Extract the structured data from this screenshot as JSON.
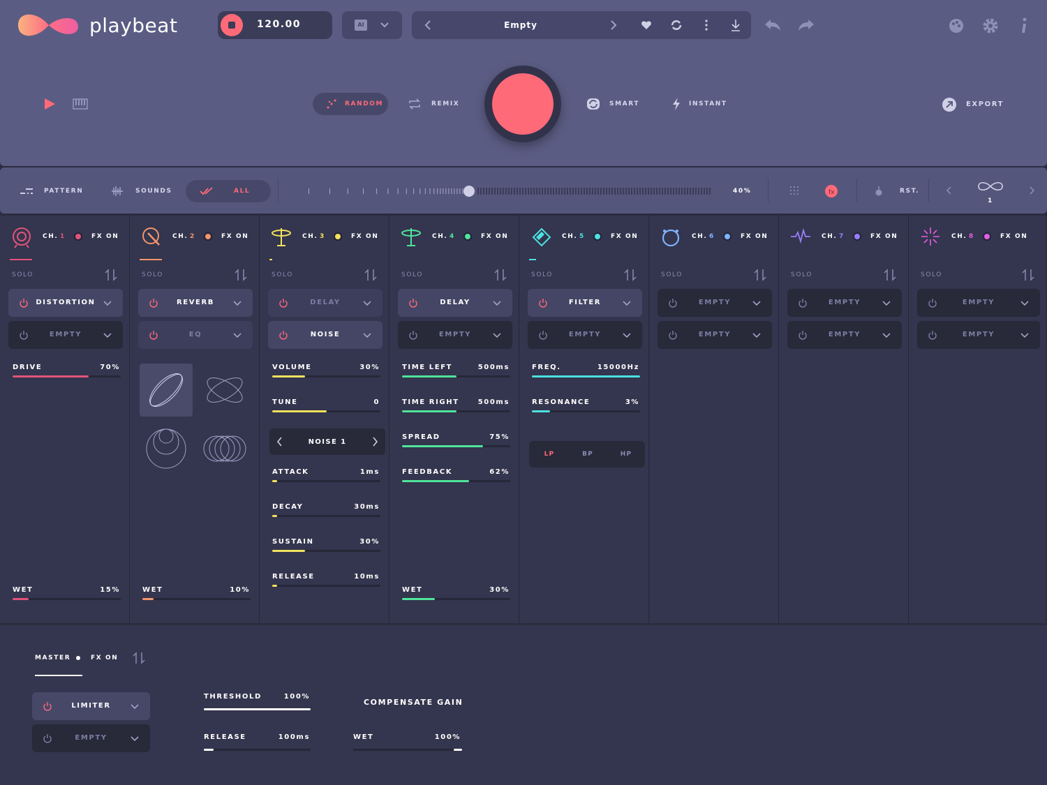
{
  "app": {
    "name": "playbeat",
    "bpm": "120.00",
    "ai_label": "AI",
    "preset": "Empty"
  },
  "actions": {
    "random": "RANDOM",
    "remix": "REMIX",
    "smart": "SMART",
    "instant": "INSTANT",
    "export": "EXPORT"
  },
  "bar2": {
    "pattern": "PATTERN",
    "sounds": "SOUNDS",
    "all": "ALL",
    "percent": "40%",
    "level": 0.4,
    "rst": "RST.",
    "loop_count": "1"
  },
  "solo": "SOLO",
  "fx_on": "FX ON",
  "channels": [
    {
      "ch": "CH.",
      "num": "1",
      "color": "#e2537a",
      "fx1": "DISTORTION",
      "fx2": "EMPTY",
      "params": [
        {
          "name": "DRIVE",
          "value": "70%",
          "level": 0.7
        }
      ],
      "wet": {
        "name": "WET",
        "value": "15%",
        "level": 0.15
      }
    },
    {
      "ch": "CH.",
      "num": "2",
      "color": "#f39669",
      "fx1": "REVERB",
      "fx2": "EQ",
      "wet": {
        "name": "WET",
        "value": "10%",
        "level": 0.1
      }
    },
    {
      "ch": "CH.",
      "num": "3",
      "color": "#f2e25d",
      "fx1": "DELAY",
      "fx2": "NOISE",
      "params": [
        {
          "name": "VOLUME",
          "value": "30%",
          "level": 0.3
        },
        {
          "name": "TUNE",
          "value": "0",
          "level": 0.5
        },
        {
          "name": "ATTACK",
          "value": "1ms",
          "level": 0.02
        },
        {
          "name": "DECAY",
          "value": "30ms",
          "level": 0.03
        },
        {
          "name": "SUSTAIN",
          "value": "30%",
          "level": 0.3
        },
        {
          "name": "RELEASE",
          "value": "10ms",
          "level": 0.02
        }
      ],
      "selector": "NOISE 1"
    },
    {
      "ch": "CH.",
      "num": "4",
      "color": "#4fe59a",
      "fx1": "DELAY",
      "fx2": "EMPTY",
      "params": [
        {
          "name": "TIME LEFT",
          "value": "500ms",
          "level": 0.5
        },
        {
          "name": "TIME RIGHT",
          "value": "500ms",
          "level": 0.5
        },
        {
          "name": "SPREAD",
          "value": "75%",
          "level": 0.75
        },
        {
          "name": "FEEDBACK",
          "value": "62%",
          "level": 0.62
        }
      ],
      "wet": {
        "name": "WET",
        "value": "30%",
        "level": 0.3
      }
    },
    {
      "ch": "CH.",
      "num": "5",
      "color": "#4be2e0",
      "fx1": "FILTER",
      "fx2": "EMPTY",
      "params": [
        {
          "name": "FREQ.",
          "value": "15000Hz",
          "level": 1.0
        },
        {
          "name": "RESONANCE",
          "value": "3%",
          "level": 0.17
        }
      ],
      "modes": [
        "LP",
        "BP",
        "HP"
      ]
    },
    {
      "ch": "CH.",
      "num": "6",
      "color": "#7fb3ff",
      "fx1": "EMPTY",
      "fx2": "EMPTY"
    },
    {
      "ch": "CH.",
      "num": "7",
      "color": "#9a7cff",
      "fx1": "EMPTY",
      "fx2": "EMPTY"
    },
    {
      "ch": "CH.",
      "num": "8",
      "color": "#e05fe0",
      "fx1": "EMPTY",
      "fx2": "EMPTY"
    }
  ],
  "master": {
    "label": "MASTER",
    "fx_on": "FX ON",
    "fx1": "LIMITER",
    "fx2": "EMPTY",
    "threshold": {
      "name": "THRESHOLD",
      "value": "100%",
      "level": 1.0
    },
    "release": {
      "name": "RELEASE",
      "value": "100ms",
      "level": 0.08
    },
    "compensate": "COMPENSATE GAIN",
    "wet": {
      "name": "WET",
      "value": "100%",
      "level": 1.0
    }
  },
  "colors": {
    "accent": "#ff6a78",
    "top_bg": "#5b5c83",
    "panel_bg": "#34354e"
  }
}
